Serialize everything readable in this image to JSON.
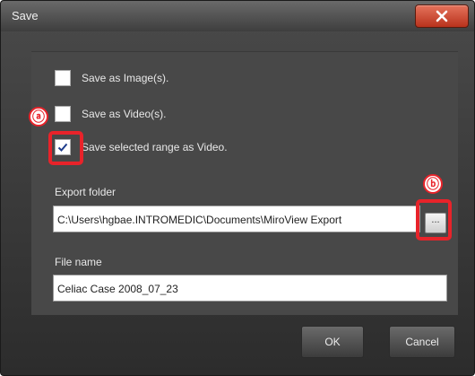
{
  "window": {
    "title": "Save"
  },
  "options": [
    {
      "label": "Save as Image(s).",
      "checked": false
    },
    {
      "label": "Save as Video(s).",
      "checked": false
    },
    {
      "label": "Save selected range as Video.",
      "checked": true
    }
  ],
  "export_folder": {
    "label": "Export folder",
    "value": "C:\\Users\\hgbae.INTROMEDIC\\Documents\\MiroView Export",
    "browse_label": "..."
  },
  "file_name": {
    "label": "File name",
    "value": "Celiac Case 2008_07_23"
  },
  "buttons": {
    "ok": "OK",
    "cancel": "Cancel"
  },
  "annotations": {
    "a": "ⓐ",
    "b": "ⓑ"
  },
  "colors": {
    "annotation": "#e8232a",
    "close_button": "#c8452c"
  },
  "icons": {
    "close": "close-icon",
    "check": "checkmark-icon"
  }
}
